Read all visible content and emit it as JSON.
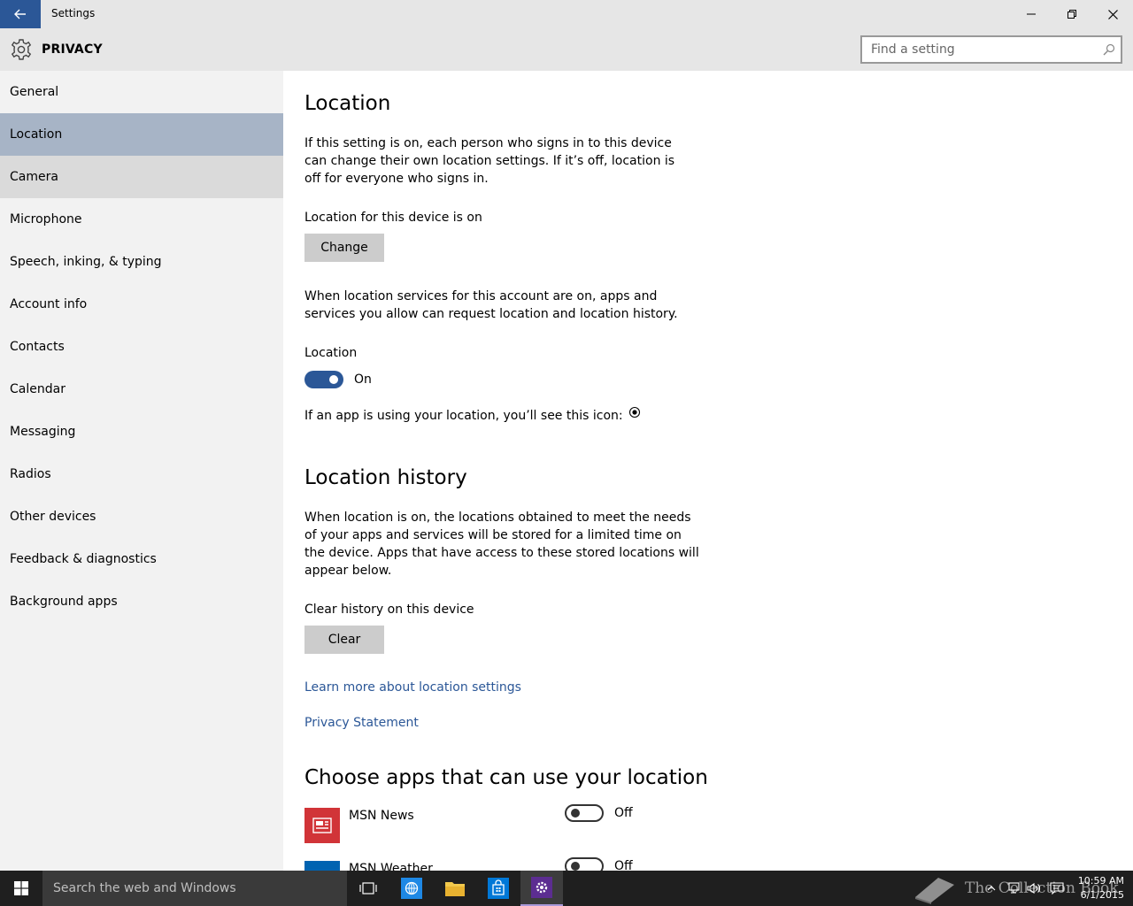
{
  "window": {
    "title": "Settings",
    "back_icon": "back-arrow-icon",
    "minimize_icon": "minimize-icon",
    "maximize_icon": "restore-icon",
    "close_icon": "close-icon"
  },
  "header": {
    "title": "PRIVACY",
    "icon": "gear-icon",
    "search_placeholder": "Find a setting"
  },
  "sidebar": {
    "items": [
      {
        "label": "General"
      },
      {
        "label": "Location",
        "selected": true
      },
      {
        "label": "Camera"
      },
      {
        "label": "Microphone"
      },
      {
        "label": "Speech, inking, & typing"
      },
      {
        "label": "Account info"
      },
      {
        "label": "Contacts"
      },
      {
        "label": "Calendar"
      },
      {
        "label": "Messaging"
      },
      {
        "label": "Radios"
      },
      {
        "label": "Other devices"
      },
      {
        "label": "Feedback & diagnostics"
      },
      {
        "label": "Background apps"
      }
    ]
  },
  "content": {
    "location_heading": "Location",
    "location_desc": "If this setting is on, each person who signs in to this device can change their own location settings. If it’s off, location is off for everyone who signs in.",
    "device_status": "Location for this device is on",
    "change_button": "Change",
    "account_desc": "When location services for this account are on, apps and services you allow can request location and location history.",
    "location_toggle_label": "Location",
    "location_toggle_state": "On",
    "icon_note": "If an app is using your location, you’ll see this icon:",
    "history_heading": "Location history",
    "history_desc": "When location is on, the locations obtained to meet the needs of your apps and services will be stored for a limited time on the device. Apps that have access to these stored locations will appear below.",
    "clear_label": "Clear history on this device",
    "clear_button": "Clear",
    "learn_more_link": "Learn more about location settings",
    "privacy_link": "Privacy Statement",
    "apps_heading": "Choose apps that can use your location",
    "apps": [
      {
        "name": "MSN News",
        "state": "Off",
        "color": "#d13438"
      },
      {
        "name": "MSN Weather",
        "state": "Off",
        "color": "#0063b1"
      }
    ]
  },
  "taskbar": {
    "search_placeholder": "Search the web and Windows",
    "watermark": "The Collection Book",
    "time": "10:59 AM",
    "date": "6/1/2015"
  },
  "colors": {
    "accent": "#2b5797",
    "selected_nav": "#a7b4c6",
    "hover_nav": "#dadada",
    "sidebar_bg": "#f2f2f2",
    "button_bg": "#cccccc"
  }
}
